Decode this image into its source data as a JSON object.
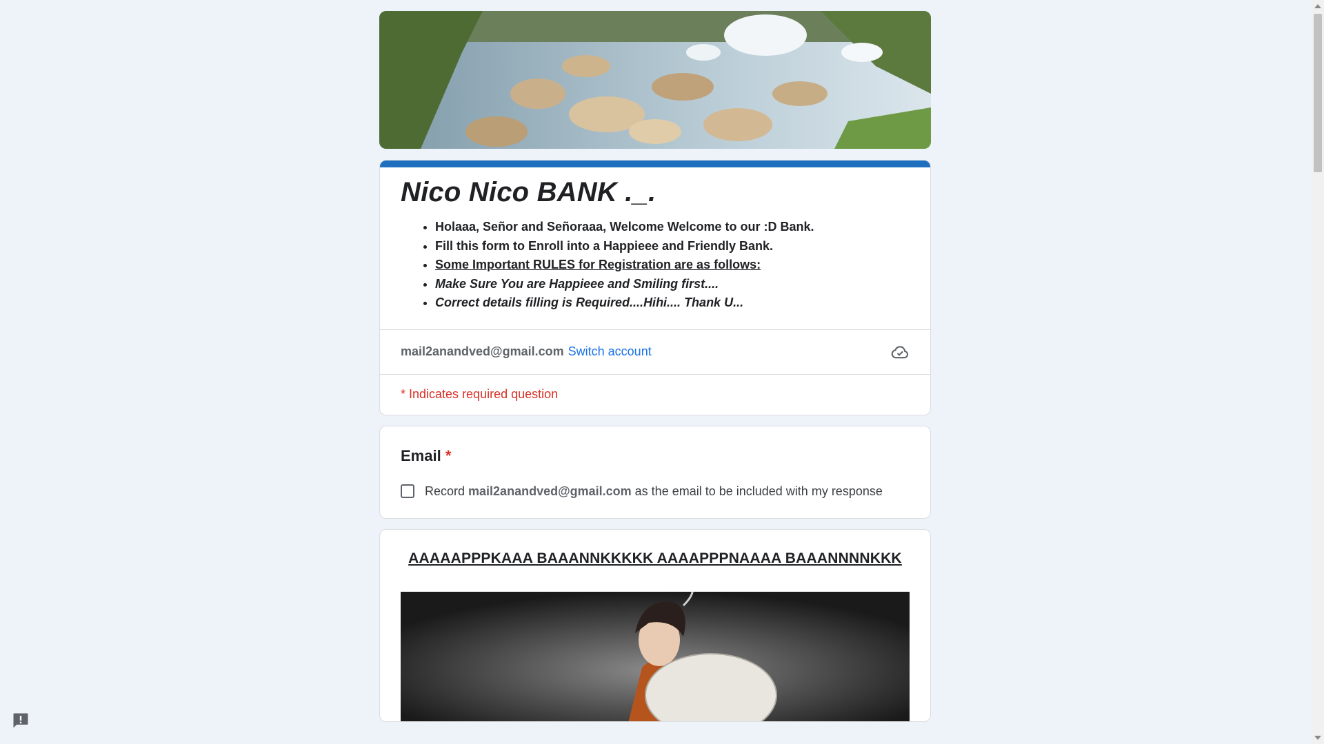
{
  "form": {
    "title": "Nico Nico BANK ._.",
    "description": [
      "Holaaa, Señor and Señoraaa, Welcome Welcome to our :D Bank.",
      "Fill this form to Enroll into a Happieee and Friendly Bank.",
      "Some Important  RULES for Registration are as follows:",
      "Make Sure You are Happieee and Smiling first....",
      "Correct details filling is Required....Hihi.... Thank U..."
    ]
  },
  "account": {
    "email": "mail2anandved@gmail.com",
    "switch_label": "Switch account",
    "required_note": "* Indicates required question"
  },
  "question_email": {
    "title": "Email",
    "required_mark": "*",
    "checkbox_prefix": "Record",
    "checkbox_email": "mail2anandved@gmail.com",
    "checkbox_suffix": "as the email to be included with my response"
  },
  "section": {
    "title": "AAAAAPPPKAAA BAAANNKKKKK AAAAPPPNAAAA BAAANNNNKKK"
  },
  "colors": {
    "accent": "#1f6fbf",
    "background": "#eef3fa",
    "required": "#d93025",
    "link": "#1a73e8"
  },
  "icons": {
    "cloud": "cloud-saved-icon",
    "feedback": "feedback-icon"
  }
}
